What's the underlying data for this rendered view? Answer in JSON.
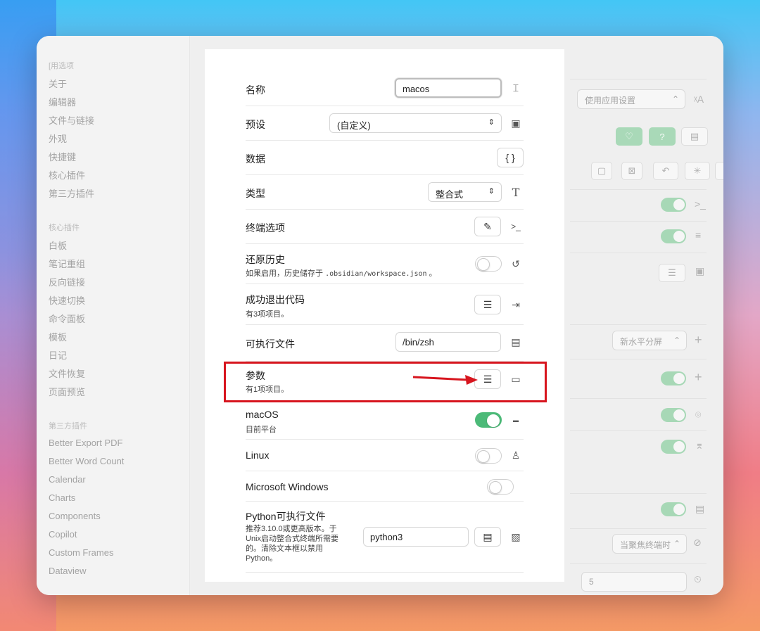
{
  "sidebar": {
    "section_general": "[用选项",
    "general_items": [
      "关于",
      "编辑器",
      "文件与链接",
      "外观",
      "快捷键",
      "核心插件",
      "第三方插件"
    ],
    "section_core": "核心插件",
    "core_items": [
      "白板",
      "笔记重组",
      "反向链接",
      "快速切换",
      "命令面板",
      "模板",
      "日记",
      "文件恢复",
      "页面预览"
    ],
    "section_third": "第三方插件",
    "third_items": [
      "Better Export PDF",
      "Better Word Count",
      "Calendar",
      "Charts",
      "Components",
      "Copilot",
      "Custom Frames",
      "Dataview"
    ]
  },
  "right_panel": {
    "app_setting_select": "使用应用设置",
    "split_select": "新水平分屏",
    "focus_select": "当聚焦终端时",
    "number_value": "5"
  },
  "modal": {
    "name_label": "名称",
    "name_value": "macos",
    "preset_label": "预设",
    "preset_value": "(自定义)",
    "data_label": "数据",
    "data_button": "{ }",
    "type_label": "类型",
    "type_value": "整合式",
    "terminal_options_label": "终端选项",
    "restore_history_label": "还原历史",
    "restore_history_desc_prefix": "如果启用，历史储存于",
    "restore_history_desc_code": ".obsidian/workspace.json",
    "restore_history_desc_suffix": "。",
    "success_exit_label": "成功退出代码",
    "success_exit_desc": "有3项项目。",
    "executable_label": "可执行文件",
    "executable_value": "/bin/zsh",
    "args_label": "参数",
    "args_desc": "有1项项目。",
    "macos_label": "macOS",
    "macos_desc": "目前平台",
    "macos_enabled": true,
    "linux_label": "Linux",
    "linux_enabled": false,
    "windows_label": "Microsoft Windows",
    "windows_enabled": false,
    "python_label": "Python可执行文件",
    "python_desc_lines": [
      "推荐3.10.0或更高版本。于",
      "Unix启动整合式终端所需要",
      "的。清除文本框以禁用",
      "Python。"
    ],
    "python_value": "python3"
  },
  "colors": {
    "toggle_on": "#4cba78",
    "highlight_box": "#d7151e",
    "arrow": "#d7151e"
  },
  "icons": {
    "name_row": "text-cursor-icon",
    "preset_row": "terminal-square-icon",
    "type_row": "type-icon",
    "terminal_options_row": "terminal-prompt-icon",
    "restore_history_row": "history-icon",
    "success_exit_row": "log-out-icon",
    "executable_row": "file-terminal-icon",
    "args_row": "text-input-icon",
    "macos_row": "apple-icon",
    "linux_row": "tux-icon",
    "python_row": "file-code-icon"
  }
}
